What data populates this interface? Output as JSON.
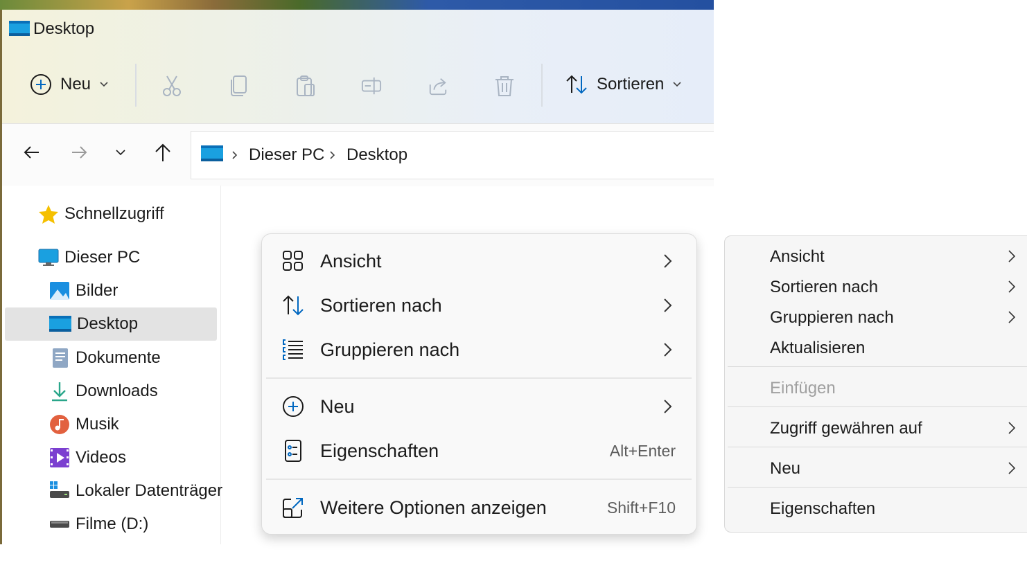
{
  "window": {
    "title": "Desktop"
  },
  "toolbar": {
    "new_label": "Neu",
    "sort_label": "Sortieren",
    "icons": [
      "cut-icon",
      "copy-icon",
      "paste-icon",
      "rename-icon",
      "share-icon",
      "delete-icon"
    ]
  },
  "address": {
    "crumbs": [
      "Dieser PC",
      "Desktop"
    ]
  },
  "nav": {
    "quick_access": "Schnellzugriff",
    "this_pc": "Dieser PC",
    "items": [
      {
        "label": "Bilder",
        "icon": "pictures-icon"
      },
      {
        "label": "Desktop",
        "icon": "desktop-icon",
        "selected": true
      },
      {
        "label": "Dokumente",
        "icon": "documents-icon"
      },
      {
        "label": "Downloads",
        "icon": "downloads-icon"
      },
      {
        "label": "Musik",
        "icon": "music-icon"
      },
      {
        "label": "Videos",
        "icon": "videos-icon"
      },
      {
        "label": "Lokaler Datenträger",
        "icon": "local-drive-icon"
      },
      {
        "label": "Filme (D:)",
        "icon": "drive-d-icon"
      }
    ]
  },
  "context_menu": {
    "items": [
      {
        "label": "Ansicht",
        "icon": "view-grid-icon",
        "submenu": true
      },
      {
        "label": "Sortieren nach",
        "icon": "sort-icon",
        "submenu": true
      },
      {
        "label": "Gruppieren nach",
        "icon": "group-list-icon",
        "submenu": true
      },
      {
        "label": "Neu",
        "icon": "plus-circle-icon",
        "submenu": true
      },
      {
        "label": "Eigenschaften",
        "icon": "properties-icon",
        "shortcut": "Alt+Enter"
      },
      {
        "label": "Weitere Optionen anzeigen",
        "icon": "more-options-icon",
        "shortcut": "Shift+F10"
      }
    ]
  },
  "classic_menu": {
    "items": [
      {
        "label": "Ansicht",
        "submenu": true
      },
      {
        "label": "Sortieren nach",
        "submenu": true
      },
      {
        "label": "Gruppieren nach",
        "submenu": true
      },
      {
        "label": "Aktualisieren",
        "submenu": false
      },
      {
        "label": "Einfügen",
        "disabled": true
      },
      {
        "label": "Zugriff gewähren auf",
        "submenu": true
      },
      {
        "label": "Neu",
        "submenu": true
      },
      {
        "label": "Eigenschaften",
        "submenu": false
      }
    ]
  },
  "colors": {
    "accent": "#0067c0",
    "selection": "#e3e3e3",
    "disabled_text": "#a0a0a0"
  }
}
